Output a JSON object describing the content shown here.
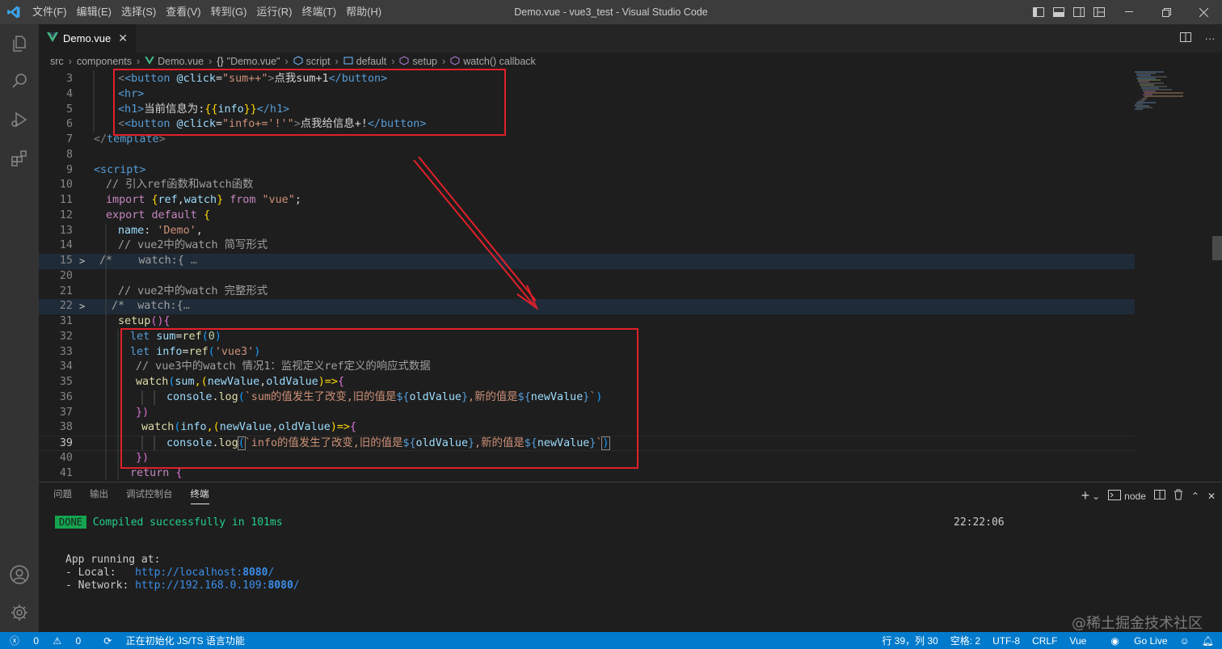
{
  "titlebar": {
    "menu": [
      "文件(F)",
      "编辑(E)",
      "选择(S)",
      "查看(V)",
      "转到(G)",
      "运行(R)",
      "终端(T)",
      "帮助(H)"
    ],
    "title": "Demo.vue - vue3_test - Visual Studio Code"
  },
  "tab": {
    "name": "Demo.vue"
  },
  "breadcrumb": {
    "items": [
      "src",
      "components",
      "Demo.vue",
      "\"Demo.vue\"",
      "script",
      "default",
      "setup",
      "watch() callback"
    ]
  },
  "editor": {
    "line_numbers": [
      "3",
      "4",
      "5",
      "6",
      "7",
      "8",
      "9",
      "10",
      "11",
      "12",
      "13",
      "14",
      "15",
      "20",
      "21",
      "22",
      "31",
      "32",
      "33",
      "34",
      "35",
      "36",
      "37",
      "38",
      "39",
      "40",
      "41"
    ],
    "code": {
      "l3": [
        "<button",
        " @click",
        "=",
        "\"sum++\"",
        ">",
        "点我sum+1",
        "</button>"
      ],
      "l4": "<hr>",
      "l5": [
        "<h1>",
        "当前信息为:",
        "{{",
        "info",
        "}}",
        "</h1>"
      ],
      "l6": [
        "<button",
        " @click",
        "=",
        "\"info+='!'\"",
        ">",
        "点我给信息+!",
        "</button>"
      ],
      "l7": [
        "</",
        "template",
        ">"
      ],
      "l9": "<script>",
      "l10": "// 引入ref函数和watch函数",
      "l11": [
        "import",
        "{",
        "ref",
        ",",
        "watch",
        "}",
        "from",
        "\"vue\"",
        ";"
      ],
      "l12": [
        "export",
        "default",
        "{"
      ],
      "l13": [
        "name",
        ": ",
        "'Demo'",
        ","
      ],
      "l14": "// vue2中的watch 简写形式",
      "l15": [
        "/*    watch:{ ",
        "…"
      ],
      "l21": "// vue2中的watch 完整形式",
      "l22": [
        "/*  watch:{",
        "…"
      ],
      "l31": [
        "setup",
        "(){"
      ],
      "l32": [
        "let",
        "sum",
        "=",
        "ref",
        "(",
        "0",
        ")"
      ],
      "l33": [
        "let",
        "info",
        "=",
        "ref",
        "(",
        "'vue3'",
        ")"
      ],
      "l34": "// vue3中的watch 情况1：监视定义ref定义的响应式数据",
      "l35": [
        "watch",
        "(",
        "sum",
        ",(",
        "newValue",
        ",",
        "oldValue",
        ")=>",
        "{"
      ],
      "l36": [
        "console",
        ".",
        "log",
        "(",
        "`sum的值发生了改变,旧的值是",
        "${",
        "oldValue",
        "}",
        ",新的值是",
        "${",
        "newValue",
        "}",
        "`",
        ")"
      ],
      "l37": [
        "})"
      ],
      "l38": [
        "watch",
        "(",
        "info",
        ",(",
        "newValue",
        ",",
        "oldValue",
        ")=>",
        "{"
      ],
      "l39": [
        "console",
        ".",
        "log",
        "(",
        "`info的值发生了改变,旧的值是",
        "${",
        "oldValue",
        "}",
        ",新的值是",
        "${",
        "newValue",
        "}",
        "`",
        ")"
      ],
      "l40": [
        "})"
      ],
      "l41": [
        "return",
        "{"
      ]
    }
  },
  "panel": {
    "tabs": [
      "问题",
      "输出",
      "调试控制台",
      "终端"
    ],
    "active_tab": "终端",
    "terminal_name": "node",
    "done_badge": "DONE",
    "compiled": "Compiled successfully in 101ms",
    "time": "22:22:06",
    "running": "App running at:",
    "local_label": "- Local:   ",
    "local_url": "http://localhost:",
    "local_port": "8080",
    "network_label": "- Network: ",
    "network_url": "http://192.168.0.109:",
    "network_port": "8080",
    "slash": "/"
  },
  "statusbar": {
    "errors": "0",
    "warnings": "0",
    "init": "正在初始化 JS/TS 语言功能",
    "position": "行 39，列 30",
    "spaces": "空格: 2",
    "encoding": "UTF-8",
    "eol": "CRLF",
    "language": "Vue",
    "golive": "Go Live"
  },
  "watermark": "@稀土掘金技术社区",
  "colors": {
    "accent": "#007acc",
    "annotation": "#e0202a",
    "done": "#14a34f"
  }
}
